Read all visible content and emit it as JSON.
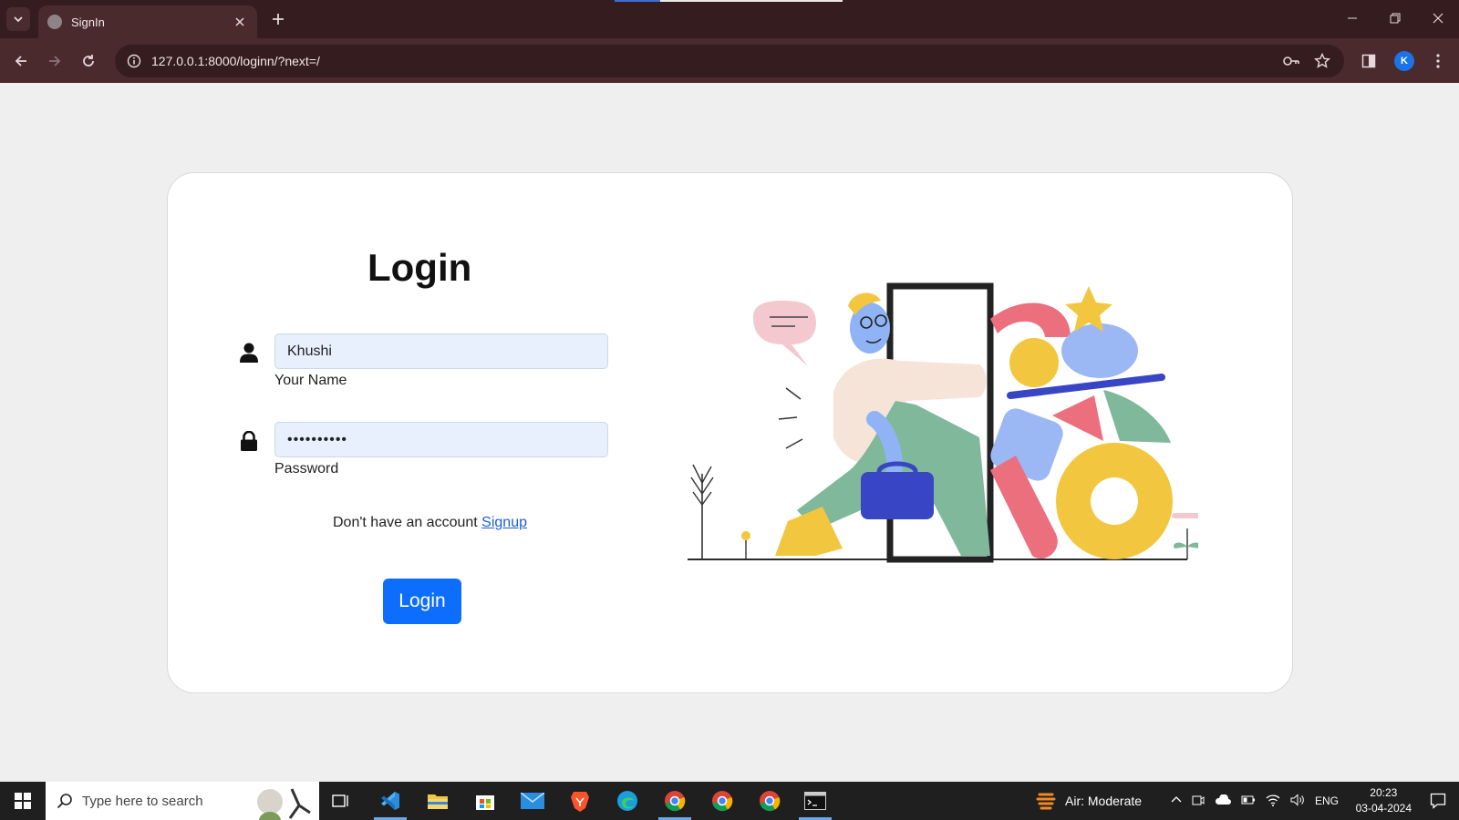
{
  "browser": {
    "tab_title": "SignIn",
    "url": "127.0.0.1:8000/loginn/?next=/",
    "profile_initial": "K"
  },
  "page": {
    "title": "Login",
    "name_field": {
      "value": "Khushi",
      "label": "Your Name"
    },
    "password_field": {
      "value": "••••••••••",
      "label": "Password"
    },
    "signup_prompt": "Don't have an account",
    "signup_link": "Signup",
    "login_button": "Login"
  },
  "taskbar": {
    "search_placeholder": "Type here to search",
    "weather": "Air: Moderate",
    "language": "ENG",
    "time": "20:23",
    "date": "03-04-2024"
  },
  "colors": {
    "browser_frame": "#351c1f",
    "browser_toolbar": "#4a2a2d",
    "page_bg": "#efefef",
    "primary_button": "#0d6efd",
    "input_bg": "#e8f0fe",
    "link": "#1a5fd0"
  }
}
